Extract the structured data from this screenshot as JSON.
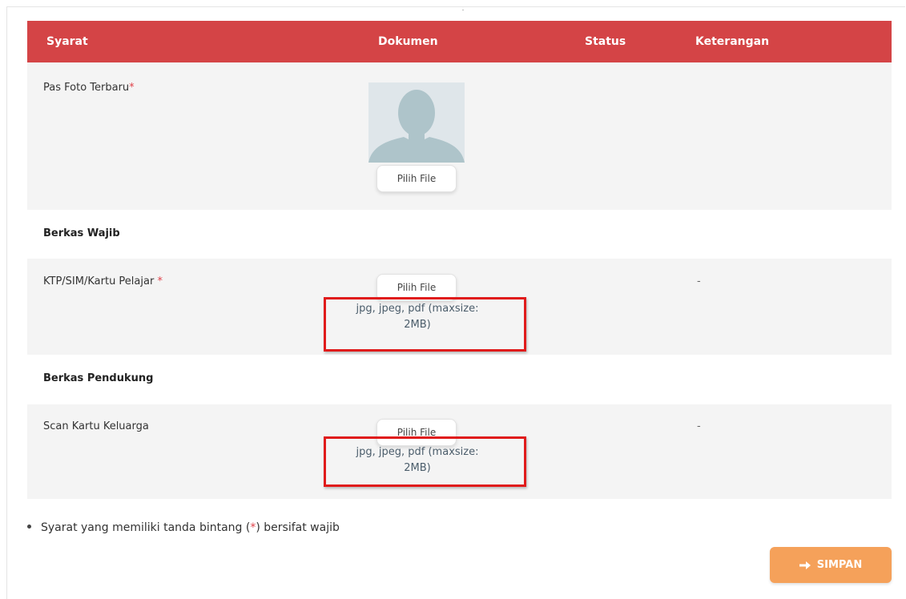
{
  "table": {
    "headers": [
      "Syarat",
      "Dokumen",
      "Status",
      "Keterangan"
    ]
  },
  "photo_row": {
    "label": "Pas Foto Terbaru",
    "required_mark": "*",
    "button": "Pilih File"
  },
  "sections": {
    "wajib_title": "Berkas Wajib",
    "pendukung_title": "Berkas Pendukung"
  },
  "ktp_row": {
    "label": "KTP/SIM/Kartu Pelajar ",
    "required_mark": "*",
    "button": "Pilih File",
    "hint_line1": "jpg, jpeg, pdf (maxsize:",
    "hint_line2": "2MB)",
    "keterangan": "-"
  },
  "kk_row": {
    "label": "Scan Kartu Keluarga",
    "button": "Pilih File",
    "hint_line1": "jpg, jpeg, pdf (maxsize:",
    "hint_line2": "2MB)",
    "keterangan": "-"
  },
  "note": {
    "before": "Syarat yang memiliki tanda bintang (",
    "star": "*",
    "after": ") bersifat wajib"
  },
  "save_button": {
    "label": "SIMPAN",
    "icon": "arrow-right-icon"
  },
  "colors": {
    "header_bg": "#d44446",
    "highlight_box": "#e01b1b",
    "save_bg": "#f5a15a"
  }
}
